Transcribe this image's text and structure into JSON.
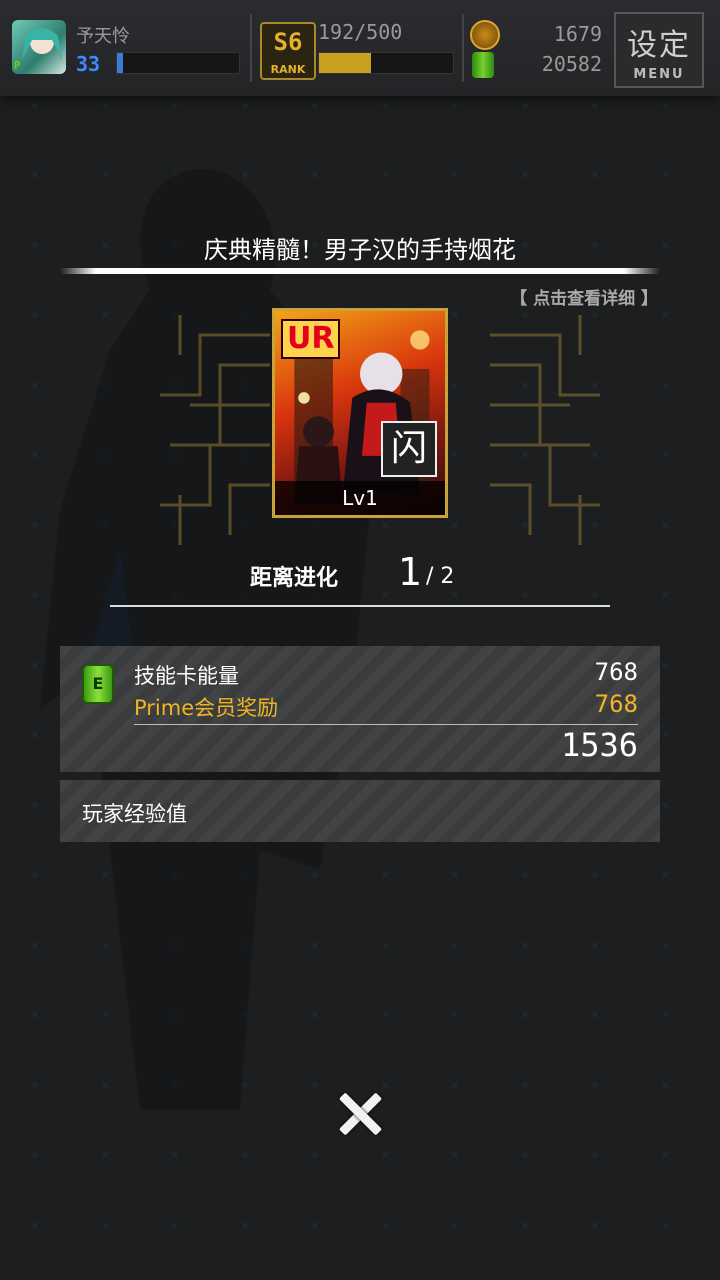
{
  "header": {
    "player_name": "予天怜",
    "player_level": "33",
    "level_progress": 0.05,
    "rank_number": "S6",
    "rank_label": "RANK",
    "exp_text": "192/500",
    "exp_progress": 0.39,
    "coin_value": "1679",
    "energy_value": "20582",
    "menu_kanji": "设定",
    "menu_label": "MENU"
  },
  "card": {
    "title": "庆典精髓！男子汉的手持烟花",
    "detail_link": "【 点击查看详细 】",
    "rarity": "UR",
    "type_glyph": "闪",
    "level": "Lv1"
  },
  "evolution": {
    "label": "距离进化",
    "current": "1",
    "total": "/ 2"
  },
  "rewards": {
    "skill_energy_label": "技能卡能量",
    "skill_energy_value": "768",
    "prime_label": "Prime会员奖励",
    "prime_value": "768",
    "total_value": "1536",
    "player_exp_label": "玩家经验值"
  },
  "colors": {
    "accent_gold": "#e3b12b",
    "prime_text": "#f0b622",
    "level_bar": "#3a7cd8",
    "energy_green": "#6ccf2a"
  },
  "icons": {
    "close": "close-icon",
    "energy": "energy-can-icon",
    "coin": "coin-icon"
  }
}
